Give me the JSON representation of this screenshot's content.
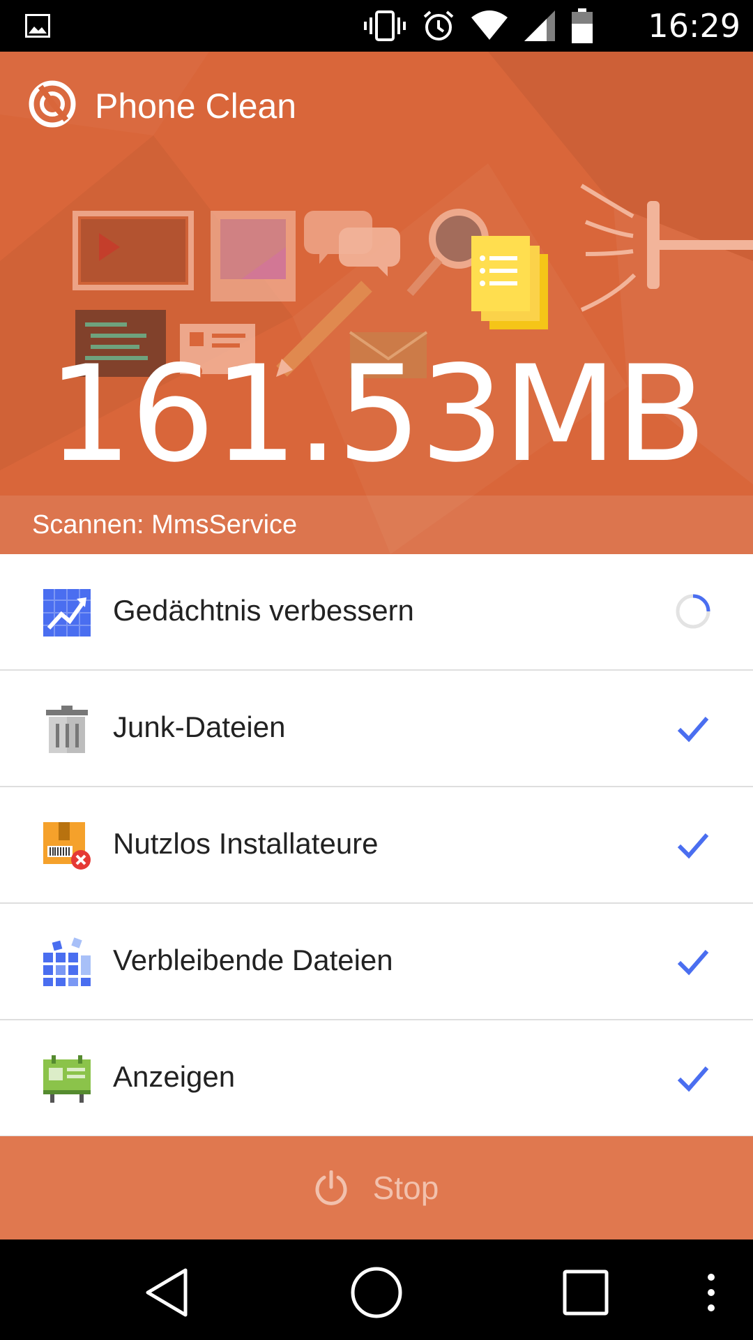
{
  "status_bar": {
    "time": "16:29",
    "icons": [
      "image-icon",
      "vibrate-icon",
      "alarm-icon",
      "wifi-icon",
      "signal-icon",
      "battery-icon"
    ]
  },
  "header": {
    "app_title": "Phone Clean",
    "size_value": "161.53MB",
    "scan_status": "Scannen: MmsService",
    "accent_color": "#d9663a"
  },
  "list": {
    "items": [
      {
        "label": "Gedächtnis verbessern",
        "icon": "chart-icon",
        "status": "loading"
      },
      {
        "label": "Junk-Dateien",
        "icon": "trash-icon",
        "status": "done"
      },
      {
        "label": "Nutzlos Installateure",
        "icon": "package-remove-icon",
        "status": "done"
      },
      {
        "label": "Verbleibende Dateien",
        "icon": "blocks-icon",
        "status": "done"
      },
      {
        "label": "Anzeigen",
        "icon": "billboard-icon",
        "status": "done"
      }
    ],
    "check_color": "#4a6ef0"
  },
  "stop": {
    "label": "Stop"
  },
  "nav_bar": {
    "icons": [
      "back-icon",
      "home-icon",
      "recents-icon",
      "menu-icon"
    ]
  }
}
